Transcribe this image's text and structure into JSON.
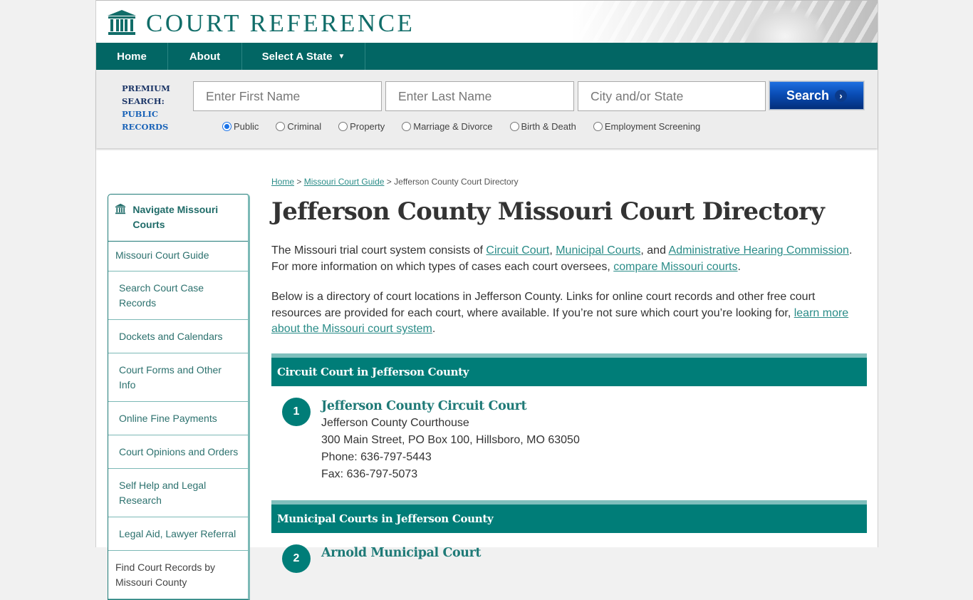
{
  "brand": {
    "name": "COURT REFERENCE",
    "color": "#116d69"
  },
  "nav": {
    "items": [
      {
        "label": "Home"
      },
      {
        "label": "About"
      },
      {
        "label": "Select A State",
        "caret": "▼"
      }
    ],
    "color": "#026664"
  },
  "search": {
    "premium_line1": "PREMIUM",
    "premium_line2": "SEARCH:",
    "premium_line3": "PUBLIC",
    "premium_line4": "RECORDS",
    "first_name_placeholder": "Enter First Name",
    "last_name_placeholder": "Enter Last Name",
    "city_placeholder": "City and/or State",
    "button_label": "Search",
    "button_arrow": "›",
    "radios": [
      {
        "label": "Public",
        "checked": true
      },
      {
        "label": "Criminal",
        "checked": false
      },
      {
        "label": "Property",
        "checked": false
      },
      {
        "label": "Marriage & Divorce",
        "checked": false
      },
      {
        "label": "Birth & Death",
        "checked": false
      },
      {
        "label": "Employment Screening",
        "checked": false
      }
    ]
  },
  "sidebar": {
    "title": "Navigate Missouri Courts",
    "items": [
      {
        "label": "Missouri Court Guide"
      },
      {
        "label": "Search Court Case Records"
      },
      {
        "label": "Dockets and Calendars"
      },
      {
        "label": "Court Forms and Other Info"
      },
      {
        "label": "Online Fine Payments"
      },
      {
        "label": "Court Opinions and Orders"
      },
      {
        "label": "Self Help and Legal Research"
      },
      {
        "label": "Legal Aid, Lawyer Referral"
      },
      {
        "label": "Find Court Records by Missouri County"
      }
    ]
  },
  "breadcrumb": {
    "home": "Home",
    "sep": ">",
    "guide": "Missouri Court Guide",
    "current": "Jefferson County Court Directory"
  },
  "page_title": "Jefferson County Missouri Court Directory",
  "intro": {
    "p1_a": "The Missouri trial court system consists of ",
    "link_circuit": "Circuit Court",
    "comma": ", ",
    "link_municipal": "Municipal Courts",
    "p1_b": ", and ",
    "link_ahc": "Administrative Hearing Commission",
    "p1_c": ". For more information on which types of cases each court oversees, ",
    "link_compare": "compare Missouri courts",
    "period": ".",
    "p2_a": "Below is a directory of court locations in Jefferson County. Links for online court records and other free court resources are provided for each court, where available. If you’re not sure which court you’re looking for, ",
    "link_learn": "learn more about the Missouri court system"
  },
  "sections": [
    {
      "title": "Circuit Court in Jefferson County",
      "courts": [
        {
          "number": "1",
          "name": "Jefferson County Circuit Court",
          "building": "Jefferson County Courthouse",
          "address": "300 Main Street, PO Box 100, Hillsboro, MO 63050",
          "phone": "Phone: 636-797-5443",
          "fax": "Fax: 636-797-5073"
        }
      ]
    },
    {
      "title": "Municipal Courts in Jefferson County",
      "courts": [
        {
          "number": "2",
          "name": "Arnold Municipal Court"
        }
      ]
    }
  ],
  "colors": {
    "teal": "#007d78",
    "link": "#2a8c88",
    "search_button": "#0a4db5"
  }
}
